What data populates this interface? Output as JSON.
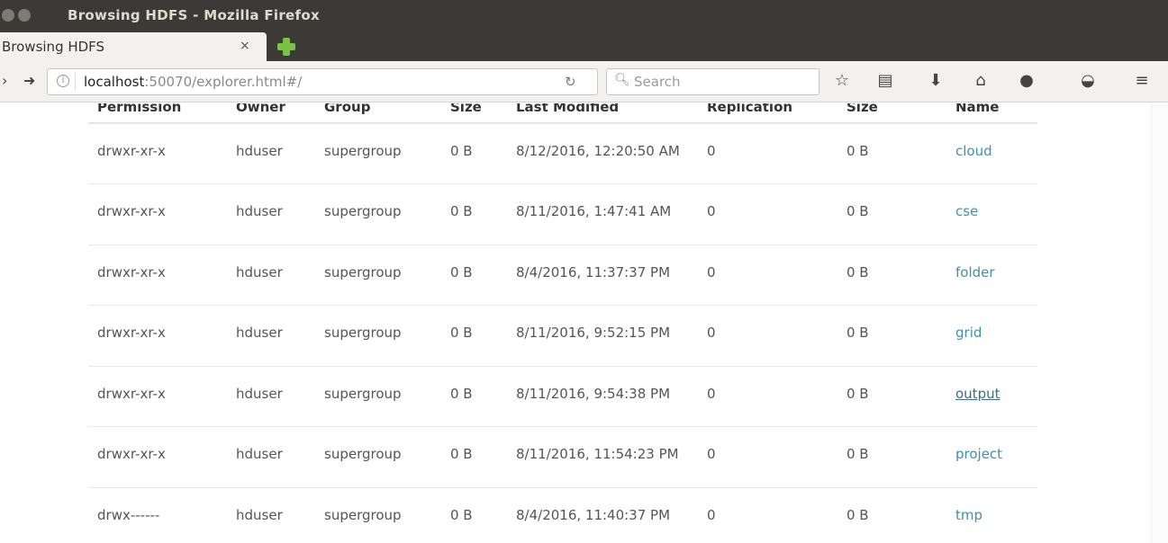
{
  "window": {
    "title": "Browsing HDFS - Mozilla Firefox"
  },
  "tab": {
    "label": "Browsing HDFS",
    "close": "×"
  },
  "nav": {
    "url_host": "localhost",
    "url_rest": ":50070/explorer.html#/",
    "search_placeholder": "Search"
  },
  "table": {
    "headers": [
      "Permission",
      "Owner",
      "Group",
      "Size",
      "Last Modified",
      "Replication",
      "Size",
      "Name"
    ],
    "rows": [
      {
        "permission": "drwxr-xr-x",
        "owner": "hduser",
        "group": "supergroup",
        "size": "0 B",
        "modified": "8/12/2016, 12:20:50 AM",
        "replication": "0",
        "block_size": "0 B",
        "name": "cloud"
      },
      {
        "permission": "drwxr-xr-x",
        "owner": "hduser",
        "group": "supergroup",
        "size": "0 B",
        "modified": "8/11/2016, 1:47:41 AM",
        "replication": "0",
        "block_size": "0 B",
        "name": "cse"
      },
      {
        "permission": "drwxr-xr-x",
        "owner": "hduser",
        "group": "supergroup",
        "size": "0 B",
        "modified": "8/4/2016, 11:37:37 PM",
        "replication": "0",
        "block_size": "0 B",
        "name": "folder"
      },
      {
        "permission": "drwxr-xr-x",
        "owner": "hduser",
        "group": "supergroup",
        "size": "0 B",
        "modified": "8/11/2016, 9:52:15 PM",
        "replication": "0",
        "block_size": "0 B",
        "name": "grid"
      },
      {
        "permission": "drwxr-xr-x",
        "owner": "hduser",
        "group": "supergroup",
        "size": "0 B",
        "modified": "8/11/2016, 9:54:38 PM",
        "replication": "0",
        "block_size": "0 B",
        "name": "output"
      },
      {
        "permission": "drwxr-xr-x",
        "owner": "hduser",
        "group": "supergroup",
        "size": "0 B",
        "modified": "8/11/2016, 11:54:23 PM",
        "replication": "0",
        "block_size": "0 B",
        "name": "project"
      },
      {
        "permission": "drwx------",
        "owner": "hduser",
        "group": "supergroup",
        "size": "0 B",
        "modified": "8/4/2016, 11:40:37 PM",
        "replication": "0",
        "block_size": "0 B",
        "name": "tmp"
      }
    ]
  },
  "icons": [
    "close-window-icon",
    "minimize-window-icon",
    "new-tab-icon",
    "back-icon",
    "forward-icon",
    "info-icon",
    "reload-icon",
    "search-icon",
    "bookmark-star-icon",
    "reading-list-icon",
    "download-icon",
    "home-icon",
    "chat-icon",
    "pocket-icon",
    "menu-icon"
  ],
  "colors": {
    "link": "#3d91ad",
    "titlebar": "#3b3a36",
    "new_tab": "#7bc142"
  }
}
